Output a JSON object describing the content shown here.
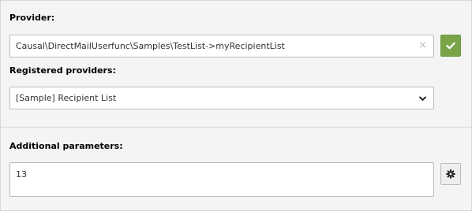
{
  "provider": {
    "label": "Provider:",
    "value": "Causal\\DirectMailUserfunc\\Samples\\TestList->myRecipientList",
    "clear_icon": "close-icon",
    "apply_icon": "check-icon",
    "apply_color": "#79a548"
  },
  "registered": {
    "label": "Registered providers:",
    "selected": "[Sample] Recipient List",
    "icon": "chevron-down-icon"
  },
  "params": {
    "label": "Additional parameters:",
    "value": "13",
    "button_icon": "gear-icon"
  }
}
